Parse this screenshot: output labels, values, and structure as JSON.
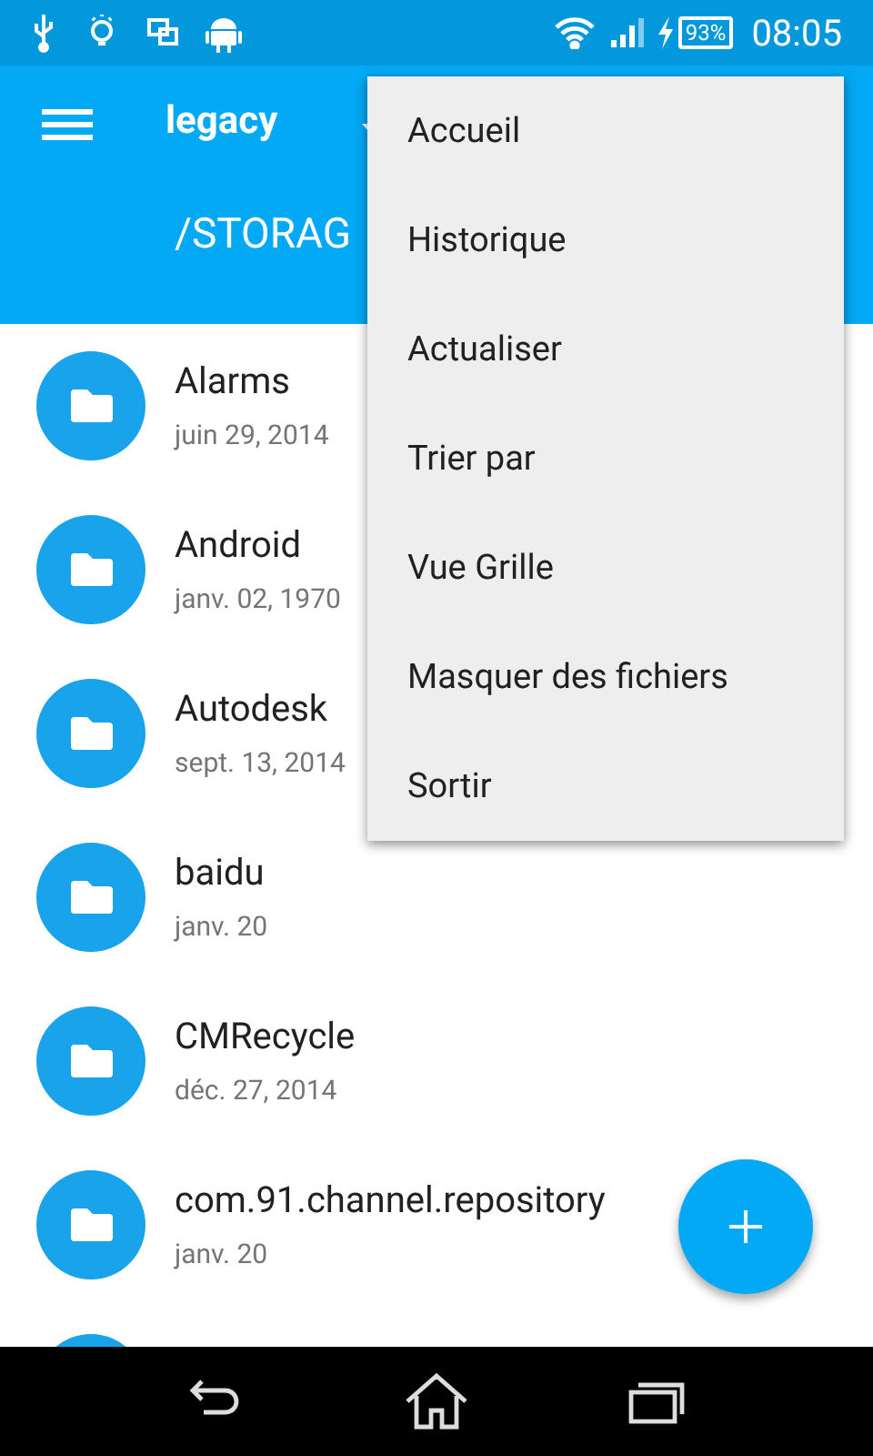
{
  "status_bar": {
    "battery": "93%",
    "time": "08:05"
  },
  "toolbar": {
    "title": "legacy",
    "path": "/STORAG"
  },
  "files": [
    {
      "name": "Alarms",
      "date": "juin 29, 2014"
    },
    {
      "name": "Android",
      "date": "janv. 02, 1970"
    },
    {
      "name": "Autodesk",
      "date": "sept. 13, 2014"
    },
    {
      "name": "baidu",
      "date": "janv. 20"
    },
    {
      "name": "CMRecycle",
      "date": "déc. 27, 2014"
    },
    {
      "name": "com.91.channel.repository",
      "date": "janv. 20"
    }
  ],
  "menu": {
    "items": [
      {
        "label": "Accueil"
      },
      {
        "label": "Historique"
      },
      {
        "label": "Actualiser"
      },
      {
        "label": "Trier par"
      },
      {
        "label": "Vue Grille"
      },
      {
        "label": "Masquer des fichiers"
      },
      {
        "label": "Sortir"
      }
    ]
  }
}
